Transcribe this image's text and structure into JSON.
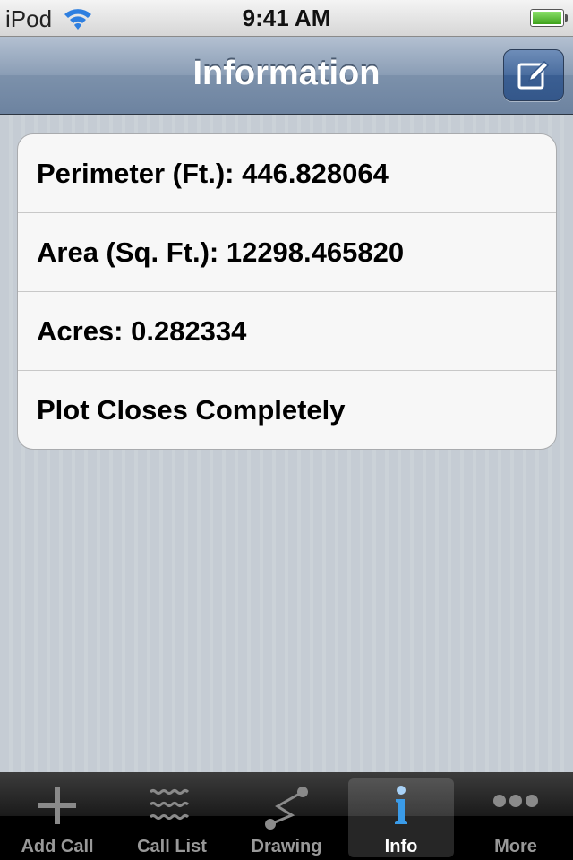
{
  "status_bar": {
    "carrier": "iPod",
    "time": "9:41 AM",
    "wifi_icon": "wifi-icon",
    "battery_icon": "battery-full-icon"
  },
  "nav_bar": {
    "title": "Information",
    "right_button_icon": "compose-icon"
  },
  "info_rows": [
    {
      "label": "Perimeter (Ft.): 446.828064"
    },
    {
      "label": "Area (Sq. Ft.): 12298.465820"
    },
    {
      "label": "Acres: 0.282334"
    },
    {
      "label": "Plot Closes Completely"
    }
  ],
  "tab_bar": {
    "tabs": [
      {
        "label": "Add Call",
        "icon": "plus-icon",
        "active": false
      },
      {
        "label": "Call List",
        "icon": "wavy-list-icon",
        "active": false
      },
      {
        "label": "Drawing",
        "icon": "drawing-icon",
        "active": false
      },
      {
        "label": "Info",
        "icon": "info-icon",
        "active": true
      },
      {
        "label": "More",
        "icon": "more-icon",
        "active": false
      }
    ]
  },
  "colors": {
    "accent": "#4a6d9f",
    "info_icon": "#3a9be8"
  }
}
